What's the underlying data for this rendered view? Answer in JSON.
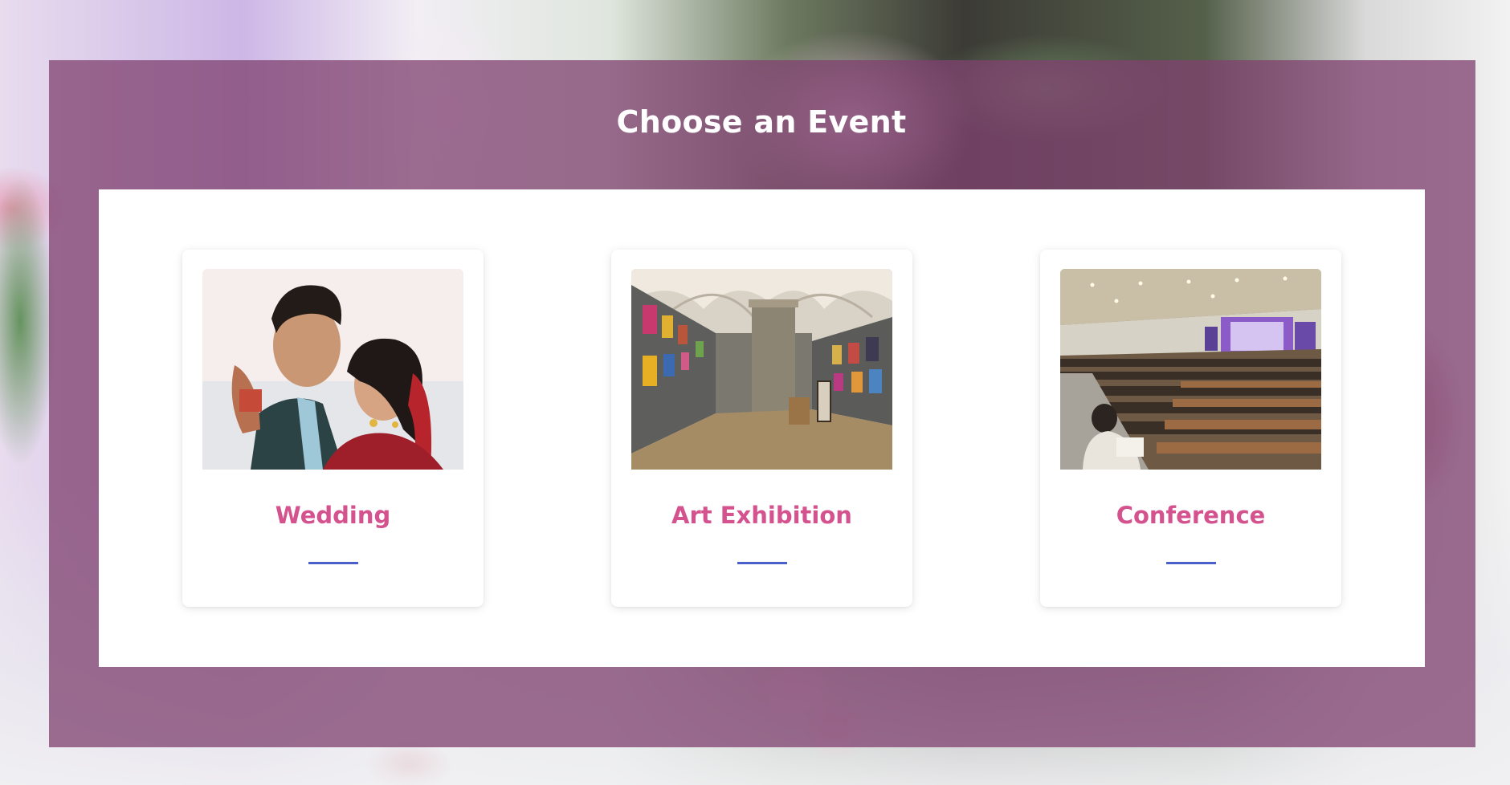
{
  "page": {
    "title": "Choose an Event"
  },
  "events": [
    {
      "label": "Wedding",
      "image": "wedding-couple-photo"
    },
    {
      "label": "Art Exhibition",
      "image": "art-gallery-photo"
    },
    {
      "label": "Conference",
      "image": "conference-hall-photo"
    }
  ],
  "colors": {
    "overlay": "#804270",
    "card_title": "#d4528e",
    "accent_rule": "#4a5fc7",
    "panel": "#ffffff",
    "heading": "#ffffff"
  }
}
